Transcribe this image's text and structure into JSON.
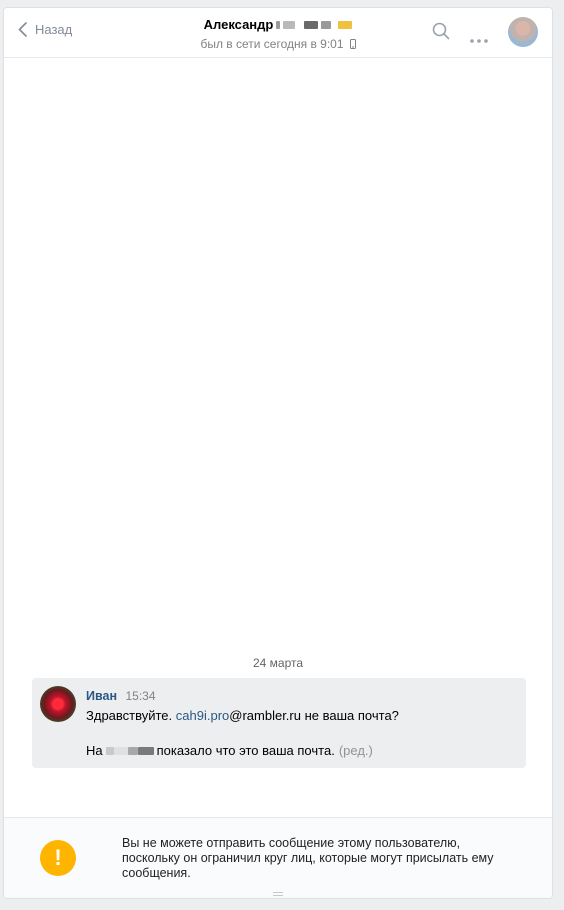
{
  "header": {
    "back_label": "Назад",
    "title_name": "Александр",
    "status": "был в сети сегодня в 9:01"
  },
  "chat": {
    "date_separator": "24 марта",
    "message": {
      "author": "Иван",
      "time": "15:34",
      "greeting": "Здравствуйте.",
      "email_link": "cah9i.pro",
      "email_rest": "@rambler.ru не ваша почта?",
      "line2_prefix": "На",
      "line2_text": "показало что это ваша почта.",
      "edited_label": "(ред.)"
    }
  },
  "footer": {
    "warning_icon_glyph": "!",
    "warning_text": "Вы не можете отправить сообщение этому пользователю, поскольку он ограничил круг лиц, которые могут присылать ему сообщения."
  },
  "colors": {
    "accent": "#2a5885",
    "warning": "#ffb400",
    "background": "#edeef0"
  },
  "icons": [
    "chevron-left-icon",
    "mobile-icon",
    "search-icon",
    "more-icon",
    "warning-icon"
  ]
}
